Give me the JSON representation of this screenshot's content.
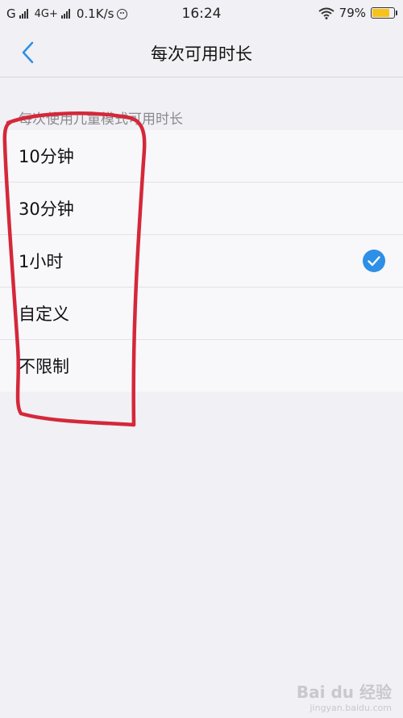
{
  "status_bar": {
    "carrier1": "G",
    "carrier2": "4G+",
    "speed": "0.1K/s",
    "time": "16:24",
    "battery": "79%",
    "battery_level": 0.79,
    "battery_color": "#f7c31b"
  },
  "nav": {
    "title": "每次可用时长"
  },
  "section_label": "每次使用儿童模式可用时长",
  "options": [
    {
      "label": "10分钟",
      "selected": false
    },
    {
      "label": "30分钟",
      "selected": false
    },
    {
      "label": "1小时",
      "selected": true
    },
    {
      "label": "自定义",
      "selected": false
    },
    {
      "label": "不限制",
      "selected": false
    }
  ],
  "colors": {
    "accent": "#2d8fe6",
    "annotation": "#d4283a"
  },
  "watermark": {
    "brand": "Bai du 经验",
    "url": "jingyan.baidu.com"
  }
}
